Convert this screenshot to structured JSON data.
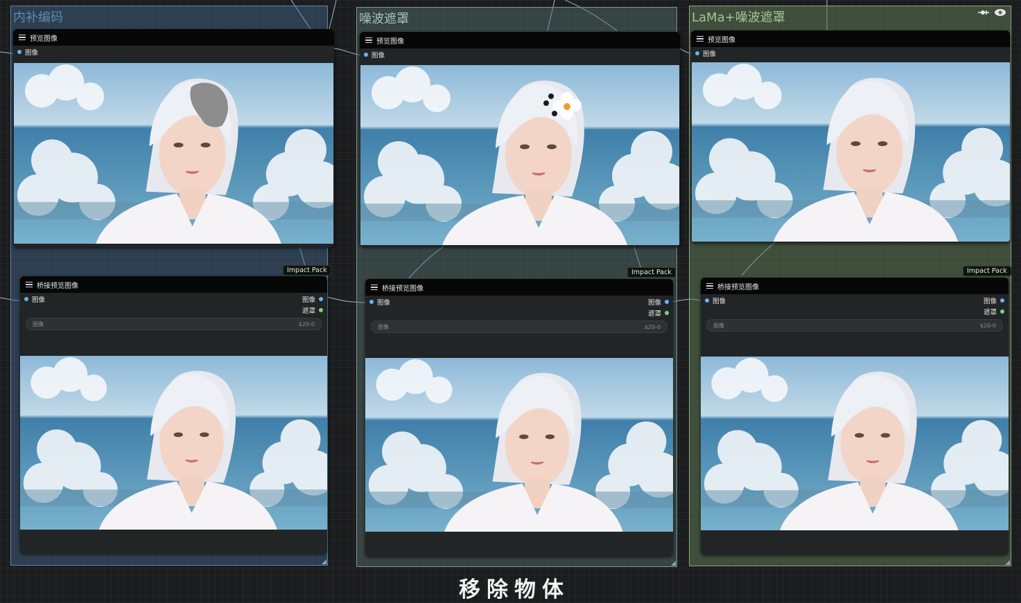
{
  "groups": {
    "inpaint": {
      "title": "内补编码"
    },
    "noise": {
      "title": "噪波遮罩"
    },
    "lama": {
      "title": "LaMa+噪波遮罩"
    }
  },
  "nodes": {
    "preview_title": "预览图像",
    "bridge_title": "桥接预览图像",
    "input_label": "图像",
    "output_image_label": "图像",
    "output_mask_label": "遮罩",
    "widget_label": "图像",
    "widget_value": "$20-0"
  },
  "badge": "Impact Pack",
  "caption": "移除物体",
  "colors": {
    "inpaint_group": "#3f607f",
    "noise_group": "#4c6262",
    "lama_group": "#5a6e50",
    "image_slot": "#64b5f6",
    "mask_slot": "#7bd67f",
    "node_header": "#070707",
    "node_body": "#222526"
  },
  "icons": [
    "menu-icon",
    "pin-icon",
    "eye-icon"
  ]
}
